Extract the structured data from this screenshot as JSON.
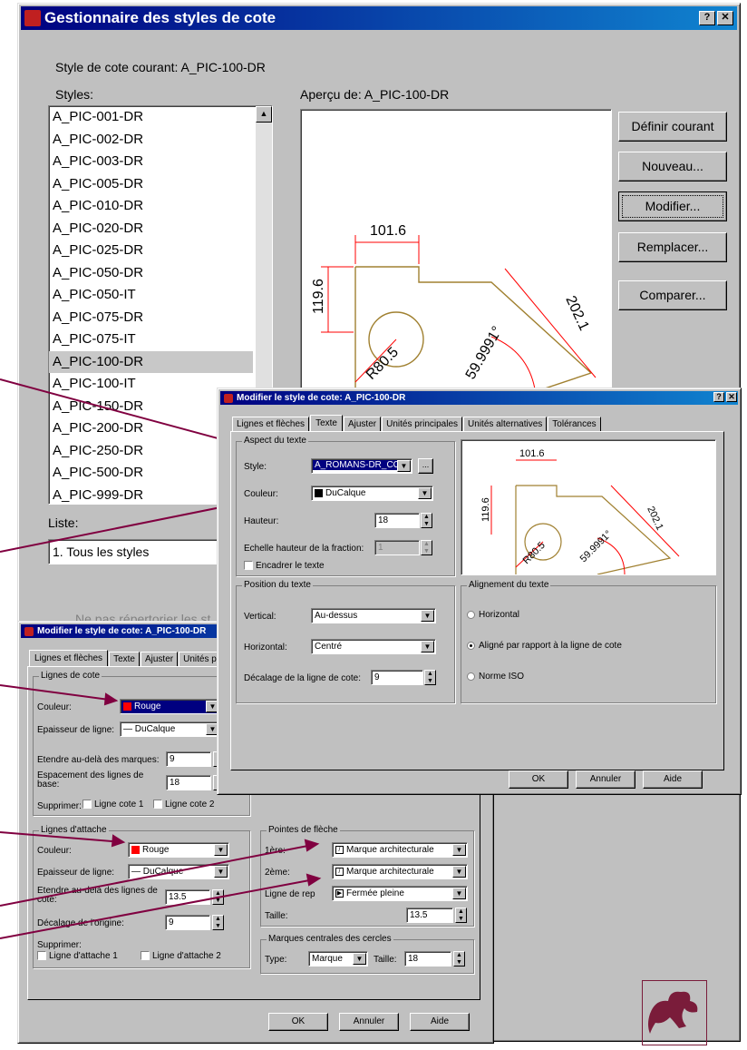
{
  "main": {
    "title": "Gestionnaire des styles de cote",
    "help_glyph": "?",
    "close_glyph": "✕",
    "current_label": "Style de cote courant: A_PIC-100-DR",
    "styles_label": "Styles:",
    "preview_label": "Aperçu de: A_PIC-100-DR",
    "styles": [
      "A_PIC-001-DR",
      "A_PIC-002-DR",
      "A_PIC-003-DR",
      "A_PIC-005-DR",
      "A_PIC-010-DR",
      "A_PIC-020-DR",
      "A_PIC-025-DR",
      "A_PIC-050-DR",
      "A_PIC-050-IT",
      "A_PIC-075-DR",
      "A_PIC-075-IT",
      "A_PIC-100-DR",
      "A_PIC-100-IT",
      "A_PIC-150-DR",
      "A_PIC-200-DR",
      "A_PIC-250-DR",
      "A_PIC-500-DR",
      "A_PIC-999-DR"
    ],
    "selected_index": 11,
    "list_label": "Liste:",
    "list_value": "1. Tous les styles",
    "hidden_checkbox_text": "Ne pas répertorier les st",
    "buttons": {
      "set_current": "Définir courant",
      "new": "Nouveau...",
      "modify": "Modifier...",
      "override": "Remplacer...",
      "compare": "Comparer..."
    }
  },
  "preview": {
    "dim_top": "101.6",
    "dim_left": "119.6",
    "dim_right": "202.1",
    "dim_radius": "R80.5",
    "dim_angle": "59.9991°"
  },
  "dlg_text": {
    "title": "Modifier le style de cote: A_PIC-100-DR",
    "tabs": [
      "Lignes et flèches",
      "Texte",
      "Ajuster",
      "Unités principales",
      "Unités alternatives",
      "Tolérances"
    ],
    "group_appearance": "Aspect du texte",
    "style_label": "Style:",
    "style_value": "A_ROMANS-DR_COT",
    "more_btn": "...",
    "color_label": "Couleur:",
    "color_value": "DuCalque",
    "height_label": "Hauteur:",
    "height_value": "18",
    "fraction_label": "Echelle hauteur de la fraction:",
    "fraction_value": "1",
    "frame_label": "Encadrer le texte",
    "group_position": "Position du texte",
    "vertical_label": "Vertical:",
    "vertical_value": "Au-dessus",
    "horizontal_label": "Horizontal:",
    "horizontal_value": "Centré",
    "offset_label": "Décalage de la ligne de cote:",
    "offset_value": "9",
    "group_align": "Alignement du texte",
    "align_horizontal": "Horizontal",
    "align_dimline": "Aligné par rapport à la ligne de cote",
    "align_iso": "Norme ISO",
    "ok": "OK",
    "cancel": "Annuler",
    "help": "Aide"
  },
  "dlg_lines": {
    "title": "Modifier le style de cote: A_PIC-100-DR",
    "tabs": [
      "Lignes et flèches",
      "Texte",
      "Ajuster",
      "Unités princi"
    ],
    "group_dimlines": "Lignes de cote",
    "color_label": "Couleur:",
    "color_value": "Rouge",
    "lineweight_label": "Epaisseur de ligne:",
    "lineweight_value": "DuCalque",
    "extend_label": "Etendre au-delà des marques:",
    "extend_value": "9",
    "baseline_label": "Espacement des lignes de base:",
    "baseline_value": "18",
    "suppress_label": "Supprimer:",
    "suppress_1": "Ligne cote 1",
    "suppress_2": "Ligne cote 2",
    "group_ext": "Lignes d'attache",
    "ext_color_label": "Couleur:",
    "ext_color_value": "Rouge",
    "ext_lineweight_label": "Epaisseur de ligne:",
    "ext_lineweight_value": "DuCalque",
    "ext_beyond_label": "Etendre au-delà des lignes de cote:",
    "ext_beyond_value": "13.5",
    "ext_offset_label": "Décalage de l'origine:",
    "ext_offset_value": "9",
    "ext_suppress_label": "Supprimer:",
    "ext_suppress_1": "Ligne d'attache 1",
    "ext_suppress_2": "Ligne d'attache 2",
    "group_arrows": "Pointes de flèche",
    "first_label": "1ère:",
    "first_value": "Marque architecturale",
    "second_label": "2ème:",
    "second_value": "Marque architecturale",
    "leader_label": "Ligne de rep",
    "leader_value": "Fermée pleine",
    "size_label": "Taille:",
    "size_value": "13.5",
    "group_center": "Marques centrales des cercles",
    "type_label": "Type:",
    "type_value": "Marque",
    "csize_label": "Taille:",
    "csize_value": "18",
    "ok": "OK",
    "cancel": "Annuler",
    "help": "Aide"
  },
  "colors": {
    "title_start": "#000080",
    "title_end": "#1084d0",
    "red": "#ff0000",
    "geometry": "#a08030",
    "logo": "#7a1c3a",
    "callout": "#800040"
  }
}
